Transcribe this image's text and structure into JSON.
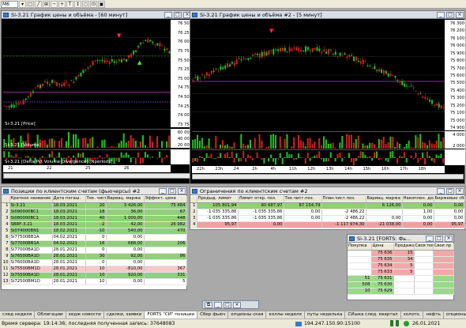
{
  "toolbar": {
    "timeframe": "M6"
  },
  "chart1": {
    "title": "Si-3.21 График цены и объёма - [60 минут]",
    "price_label": "Si-3.21 [Price]",
    "volume_label": "Si-3.21 [Volume]",
    "delta_label": "Si-3.21 [Delta Pct Volume Divergence] [Nperiod:i]",
    "price_axis": [
      "76 500",
      "76 250",
      "76 000",
      "75 750",
      "75 500",
      "75 250",
      "75 000",
      "74 750",
      "74 500",
      "74 250",
      "74 000",
      "73 750"
    ],
    "volume_axis": [
      "60 000",
      "40 000",
      "20 000"
    ],
    "x_labels": [
      "21",
      "22",
      "25",
      "26"
    ]
  },
  "chart2": {
    "title": "Si-3.21 График цены и объёма #2 - [5 минут]",
    "price_axis": [
      "76 300",
      "76 200",
      "76 100",
      "76 000",
      "75 900",
      "75 800",
      "75 700",
      "75 600",
      "75 500",
      "75 400",
      "75 300",
      "75 200",
      "75 100",
      "75 000",
      "74 900"
    ],
    "volume_axis": [
      "4 000",
      "2 000"
    ],
    "x_labels": [
      "22h",
      "23h",
      "24",
      "2h",
      "4h",
      "11h",
      "12h",
      "13h",
      "14h",
      "15h",
      "16h",
      "17h",
      "18h"
    ]
  },
  "positions": {
    "title": "Позиции по клиентским счетам (фьючерсы) #2",
    "columns": [
      "Краткое название",
      "Дата погаш.",
      "Тек. чист.",
      "Вариац. маржа",
      "Эффект. цена"
    ],
    "rows": [
      {
        "n": "1",
        "name": "Si-3.21",
        "date": "18.03.2021",
        "qty": "20",
        "vm": "3 426,00",
        "price": "75 484",
        "cls": "g"
      },
      {
        "n": "2",
        "name": "Si090000BC1",
        "date": "18.03.2021",
        "qty": "18",
        "vm": "36,00",
        "price": "67",
        "cls": "g"
      },
      {
        "n": "3",
        "name": "Si080000BC1",
        "date": "18.03.2021",
        "qty": "40",
        "vm": "1 000,00",
        "price": "448",
        "cls": "g"
      },
      {
        "n": "4",
        "name": "SBRF-3.21",
        "date": "18.03.2021",
        "qty": "-2",
        "vm": "42,00",
        "price": "26 982",
        "cls": "g"
      },
      {
        "n": "5",
        "name": "Si074000BN1",
        "date": "18.02.2021",
        "qty": "-10",
        "vm": "540,00",
        "price": "470",
        "cls": "g"
      },
      {
        "n": "6",
        "name": "Si77500BB1A",
        "date": "04.02.2021",
        "qty": "0",
        "vm": "0,00",
        "price": "",
        "cls": "s"
      },
      {
        "n": "7",
        "name": "Si77000BB1A",
        "date": "04.02.2021",
        "qty": "16",
        "vm": "688,00",
        "price": "206",
        "cls": "g"
      },
      {
        "n": "8",
        "name": "Si77000BA1D",
        "date": "28.01.2021",
        "qty": "0",
        "vm": "0,00",
        "price": "",
        "cls": "s"
      },
      {
        "n": "9",
        "name": "Si76500BA1D",
        "date": "28.01.2021",
        "qty": "30",
        "vm": "92,00",
        "price": "86",
        "cls": "g"
      },
      {
        "n": "10",
        "name": "Si76000BA1D",
        "date": "28.01.2021",
        "qty": "0",
        "vm": "0,00",
        "price": "",
        "cls": "s"
      },
      {
        "n": "11",
        "name": "Si75500BM1D",
        "date": "28.01.2021",
        "qty": "10",
        "vm": "-810,00",
        "price": "367",
        "cls": "sel"
      },
      {
        "n": "12",
        "name": "Si75500BA1D",
        "date": "28.01.2021",
        "qty": "10",
        "vm": "920,00",
        "price": "331",
        "cls": "g"
      },
      {
        "n": "13",
        "name": "Si72500BM1D",
        "date": "28.01.2021",
        "qty": "10",
        "vm": "0,00",
        "price": "5",
        "cls": "s"
      }
    ]
  },
  "limits": {
    "title": "Ограничения по клиентским счетам #2",
    "columns": [
      "Предыд. лимит",
      "Лимит откр. поз.",
      "Тек.чист.поз.",
      "План.чист.поз.",
      "Вариац. маржа",
      "Накоплен. доход",
      "Биржевые сборы"
    ],
    "rows": [
      {
        "n": "1",
        "c": [
          "105 801,94",
          "80 687,97",
          "87 154,79",
          "",
          "6 126,00",
          "0,00",
          "0,00"
        ],
        "cls": "g"
      },
      {
        "n": "2",
        "c": [
          "-1 035 335,86",
          "-1 035 335,86",
          "0,00",
          "-2 486,22",
          "",
          "1,00",
          "0,00"
        ],
        "cls": "s"
      },
      {
        "n": "3",
        "c": [
          "-1 035 335,86",
          "-1 035 335,86",
          "0,00",
          "-2 486,22",
          "0,00",
          "0,00",
          "0,00"
        ],
        "cls": "s"
      },
      {
        "n": "4",
        "c": [
          "95,97",
          "0,00",
          "",
          "-1 117 974,30",
          "-21 038,00",
          "0,00",
          "95,97"
        ],
        "cls": "r"
      }
    ]
  },
  "orderbook": {
    "title": "Si-3.21 [FORTS: Фь...",
    "columns": [
      "Покупка",
      "Цена",
      "Продажа",
      "Своя пок",
      "Своя пр"
    ],
    "rows": [
      {
        "buy": "",
        "price": "75 636",
        "sell": "15",
        "side": "ask"
      },
      {
        "buy": "",
        "price": "75 635",
        "sell": "34",
        "side": "ask"
      },
      {
        "buy": "",
        "price": "75 634",
        "sell": "5",
        "side": "ask"
      },
      {
        "buy": "",
        "price": "75 633",
        "sell": "5",
        "side": "ask"
      },
      {
        "buy": "51",
        "price": "75 631",
        "sell": "",
        "side": "bid"
      },
      {
        "buy": "508",
        "price": "75 630",
        "sell": "",
        "side": "bid"
      },
      {
        "buy": "10",
        "price": "75 629",
        "sell": "",
        "side": "bid"
      }
    ]
  },
  "tabs": [
    "след неделя",
    "Облигации",
    "хедж новости",
    "сделки, заявки",
    "FORTS \"СИ\" позиции",
    "Сбер фьюч",
    "опционы ская",
    "коллы неделя",
    "путы неделька",
    "СИшка след. квартал",
    "золото.",
    "нефть",
    "опционы ртс"
  ],
  "active_tab_index": 4,
  "status": {
    "server_time": "Время сервера: 19:14:36; последняя полученная запись: 37648083",
    "connection": "194.247.150.90:15100",
    "date": "26.01.2021"
  },
  "colors": {
    "bull": "#20c020",
    "bear": "#d02020",
    "bg": "#000000",
    "grid": "#404040"
  }
}
